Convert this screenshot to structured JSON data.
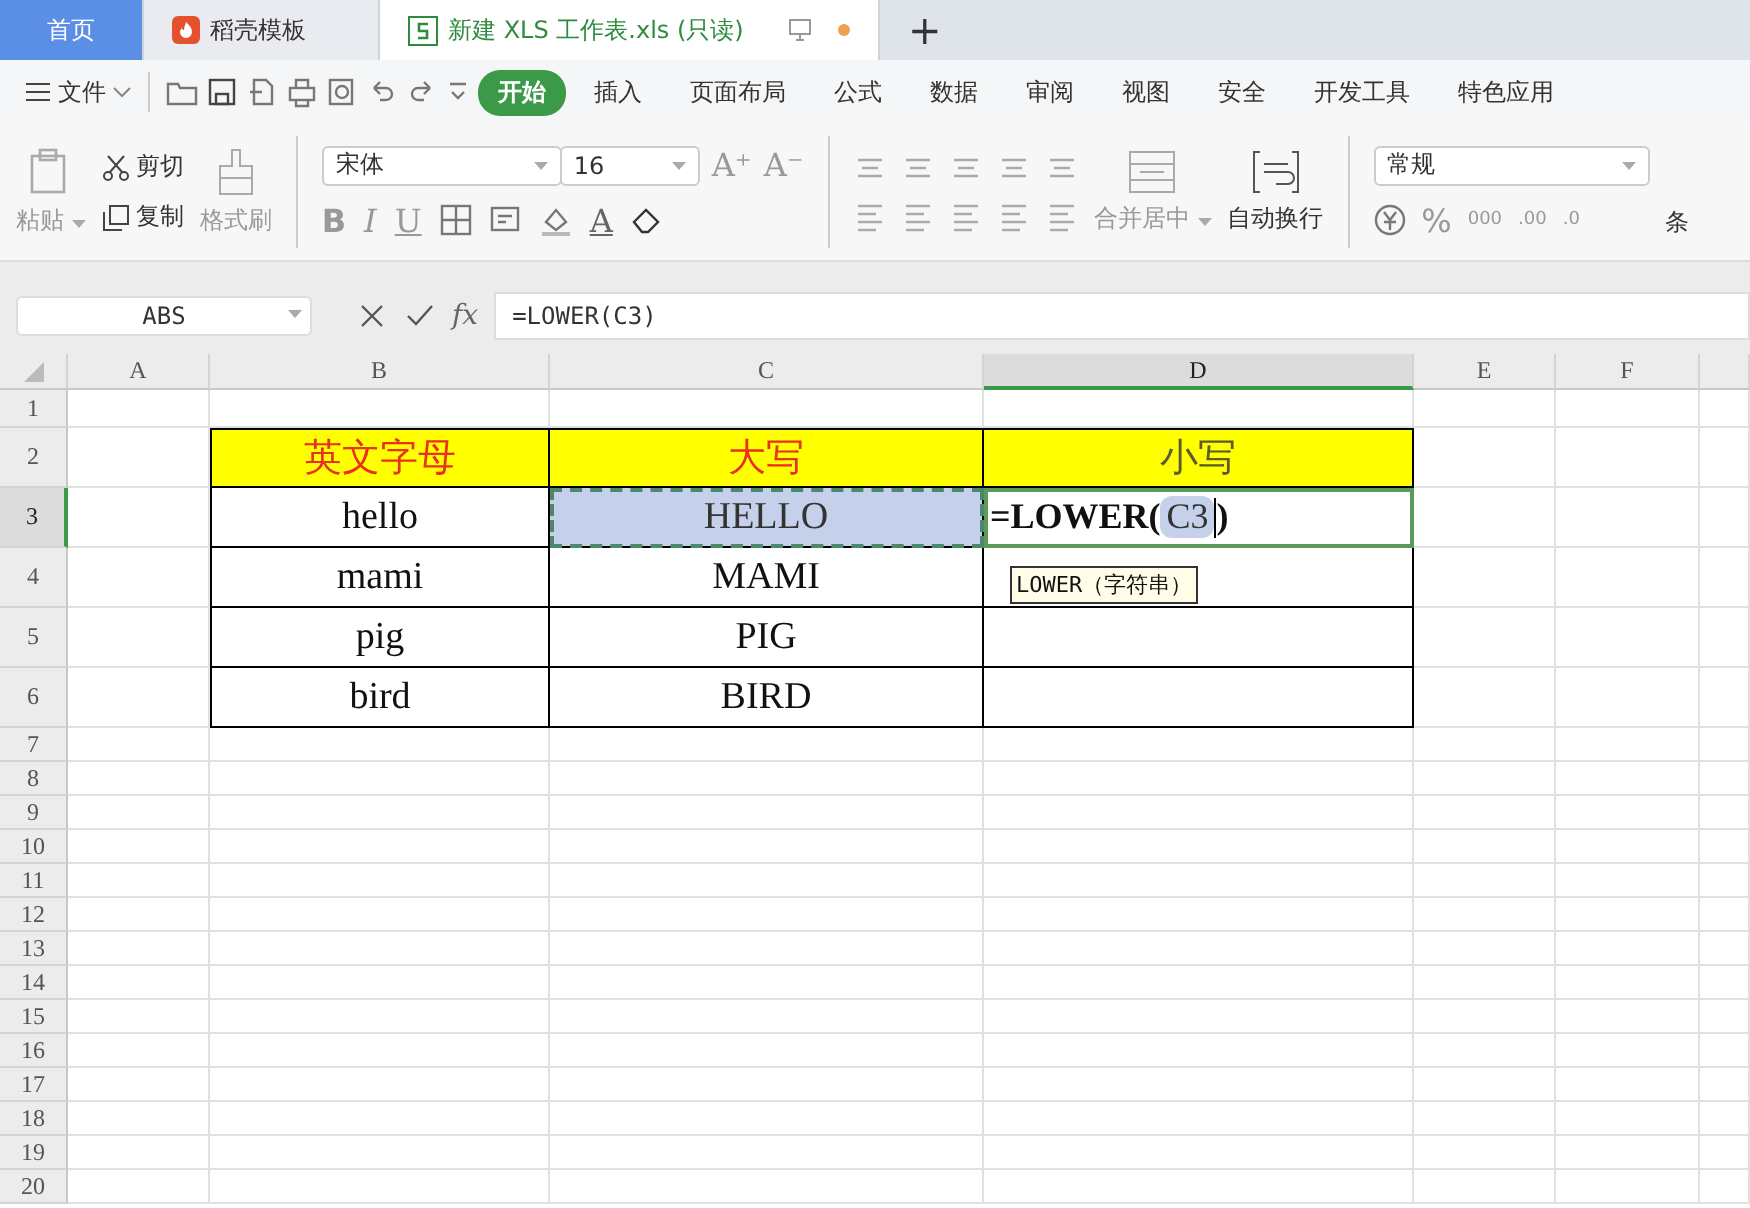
{
  "tabs": [
    {
      "label": "首页",
      "kind": "home",
      "selected": false
    },
    {
      "label": "稻壳模板",
      "kind": "docer",
      "selected": false
    },
    {
      "label": "新建 XLS 工作表.xls (只读)",
      "kind": "sheet",
      "selected": true
    }
  ],
  "new_tab": "+",
  "menu": {
    "file": "文件",
    "items": [
      {
        "label": "开始",
        "selected": true
      },
      {
        "label": "插入",
        "selected": false
      },
      {
        "label": "页面布局",
        "selected": false
      },
      {
        "label": "公式",
        "selected": false
      },
      {
        "label": "数据",
        "selected": false
      },
      {
        "label": "审阅",
        "selected": false
      },
      {
        "label": "视图",
        "selected": false
      },
      {
        "label": "安全",
        "selected": false
      },
      {
        "label": "开发工具",
        "selected": false
      },
      {
        "label": "特色应用",
        "selected": false
      }
    ]
  },
  "ribbon": {
    "paste": "粘贴",
    "cut": "剪切",
    "copy": "复制",
    "format_painter": "格式刷",
    "font": "宋体",
    "size": "16",
    "grow": "A⁺",
    "shrink": "A⁻",
    "bold": "B",
    "italic": "I",
    "underline": "U",
    "font_color": "A",
    "merge": "合并居中",
    "wrap": "自动换行",
    "number_format": "常规",
    "percent": "%",
    "thousands": "000",
    "increase_decimal": ".00",
    "decrease_decimal": ".0",
    "conditional": "条"
  },
  "formula_bar": {
    "name_box": "ABS",
    "fx": "fx",
    "formula": "=LOWER(C3)"
  },
  "sheet": {
    "columns": [
      {
        "label": "A",
        "selected": false
      },
      {
        "label": "B",
        "selected": false
      },
      {
        "label": "C",
        "selected": false
      },
      {
        "label": "D",
        "selected": true
      },
      {
        "label": "E",
        "selected": false
      },
      {
        "label": "F",
        "selected": false
      }
    ],
    "rows": [
      {
        "label": "1",
        "selected": false
      },
      {
        "label": "2",
        "selected": false,
        "cells": [
          {
            "kind": "header",
            "text": "英文字母",
            "color": "#e8311f"
          },
          {
            "kind": "header",
            "text": "大写",
            "color": "#e8311f"
          },
          {
            "kind": "header",
            "text": "小写",
            "color": "#5a5a2a"
          }
        ]
      },
      {
        "label": "3",
        "selected": true,
        "cells": [
          {
            "kind": "plain",
            "text": "hello"
          },
          {
            "kind": "marquee",
            "text": "HELLO"
          },
          {
            "kind": "editing",
            "parts": [
              "=LOWER(",
              "C3",
              ")"
            ],
            "tooltip": "LOWER（字符串）"
          }
        ]
      },
      {
        "label": "4",
        "selected": false,
        "cells": [
          {
            "kind": "plain",
            "text": "mami"
          },
          {
            "kind": "plain",
            "text": "MAMI"
          },
          {
            "kind": "empty"
          }
        ]
      },
      {
        "label": "5",
        "selected": false,
        "cells": [
          {
            "kind": "plain",
            "text": "pig"
          },
          {
            "kind": "plain",
            "text": "PIG"
          },
          {
            "kind": "empty"
          }
        ]
      },
      {
        "label": "6",
        "selected": false,
        "cells": [
          {
            "kind": "plain",
            "text": "bird"
          },
          {
            "kind": "plain",
            "text": "BIRD"
          },
          {
            "kind": "empty"
          }
        ]
      },
      {
        "label": "7",
        "selected": false
      },
      {
        "label": "8",
        "selected": false
      },
      {
        "label": "9",
        "selected": false
      },
      {
        "label": "10",
        "selected": false
      },
      {
        "label": "11",
        "selected": false
      },
      {
        "label": "12",
        "selected": false
      },
      {
        "label": "13",
        "selected": false
      },
      {
        "label": "14",
        "selected": false
      },
      {
        "label": "15",
        "selected": false
      },
      {
        "label": "16",
        "selected": false
      },
      {
        "label": "17",
        "selected": false
      },
      {
        "label": "18",
        "selected": false
      },
      {
        "label": "19",
        "selected": false
      },
      {
        "label": "20",
        "selected": false
      }
    ]
  }
}
